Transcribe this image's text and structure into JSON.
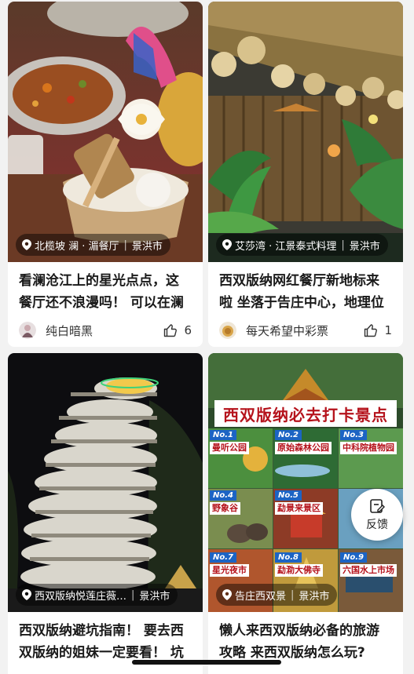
{
  "feed": {
    "cards": [
      {
        "location": "北榄坡 澜 · 湄餐厅",
        "city": "景洪市",
        "title": "看澜沧江上的星光点点，这餐厅还不浪漫吗！ 可以在澜",
        "author": "纯白暗黑",
        "likes": "6"
      },
      {
        "location": "艾莎湾 · 江景泰式料理",
        "city": "景洪市",
        "title": "西双版纳网红餐厅新地标来啦 坐落于告庄中心，地理位",
        "author": "每天希望中彩票",
        "likes": "1"
      },
      {
        "location": "西双版纳悦莲庄薇…",
        "city": "景洪市",
        "title": "西双版纳避坑指南！ 要去西双版纳的姐妹一定要看！ 坑",
        "author": "",
        "likes": ""
      },
      {
        "location": "告庄西双景",
        "city": "景洪市",
        "title": "懒人来西双版纳必备的旅游攻略 来西双版纳怎么玩?",
        "author": "",
        "likes": ""
      }
    ],
    "poster": {
      "headline": "西双版纳必去打卡景点",
      "spots": [
        {
          "no": "No.1",
          "name": "曼听公园"
        },
        {
          "no": "No.2",
          "name": "原始森林公园"
        },
        {
          "no": "No.3",
          "name": "中科院植物园"
        },
        {
          "no": "No.4",
          "name": "野象谷"
        },
        {
          "no": "No.5",
          "name": "勐景来景区"
        },
        {
          "no": "No.7",
          "name": "星光夜市"
        },
        {
          "no": "No.8",
          "name": "勐泐大佛寺"
        },
        {
          "no": "No.9",
          "name": "六国水上市场"
        }
      ]
    }
  },
  "feedback_button": {
    "label": "反馈"
  },
  "icons": {
    "location": "map-pin-icon",
    "like": "thumbs-up-icon",
    "feedback": "edit-feedback-icon"
  },
  "colors": {
    "poster_red": "#b5121b",
    "poster_badge_blue": "#1c64c4"
  }
}
